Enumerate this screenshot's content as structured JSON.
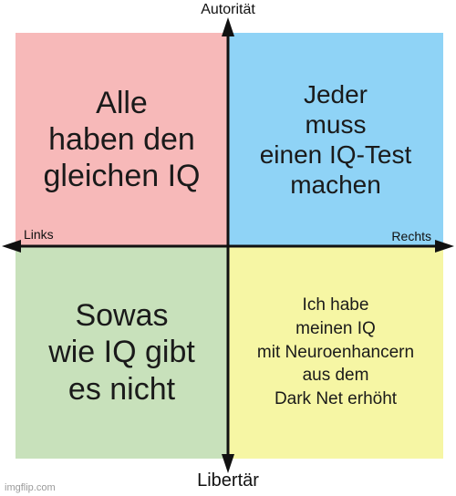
{
  "colors": {
    "top_left": "#f7b9b9",
    "top_right": "#8fd3f6",
    "bottom_left": "#c8e1bb",
    "bottom_right": "#f6f6a4",
    "axis": "#111111"
  },
  "axes": {
    "top": "Autorität",
    "bottom": "Libertär",
    "left": "Links",
    "right": "Rechts"
  },
  "quadrants": {
    "top_left": [
      "Alle",
      "haben den",
      "gleichen IQ"
    ],
    "top_right": [
      "Jeder",
      "muss",
      "einen IQ-Test",
      "machen"
    ],
    "bottom_left": [
      "Sowas",
      "wie IQ gibt",
      "es nicht"
    ],
    "bottom_right": [
      "Ich habe",
      "meinen IQ",
      "mit Neuroenhancern",
      "aus dem",
      "Dark Net erhöht"
    ]
  },
  "watermark": "imgflip.com"
}
